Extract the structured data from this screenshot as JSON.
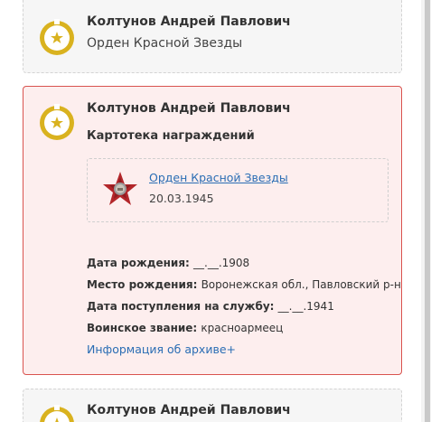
{
  "cards": [
    {
      "name": "Колтунов Андрей Павлович",
      "subtitle": "Орден Красной Звезды",
      "medal_icon": "gold-star-medal-icon"
    },
    {
      "name": "Колтунов Андрей Павлович",
      "subtitle": "Картотека награждений",
      "medal_icon": "gold-star-medal-icon",
      "award": {
        "title": "Орден Красной Звезды",
        "date": "20.03.1945",
        "icon": "red-star-order-icon"
      },
      "details": [
        {
          "label": "Дата рождения:",
          "value": "__.__.1908"
        },
        {
          "label": "Место рождения:",
          "value": "Воронежская обл., Павловский р-н"
        },
        {
          "label": "Дата поступления на службу:",
          "value": "__.__.1941"
        },
        {
          "label": "Воинское звание:",
          "value": "красноармеец"
        }
      ],
      "archive_link": "Информация об архиве+"
    },
    {
      "name": "Колтунов Андрей Павлович",
      "medal_icon": "gold-star-medal-icon"
    }
  ],
  "colors": {
    "accent_link": "#2a6db4",
    "active_border": "#d9534f",
    "active_bg": "#fdeeee",
    "medal_gold": "#d9b21f"
  }
}
